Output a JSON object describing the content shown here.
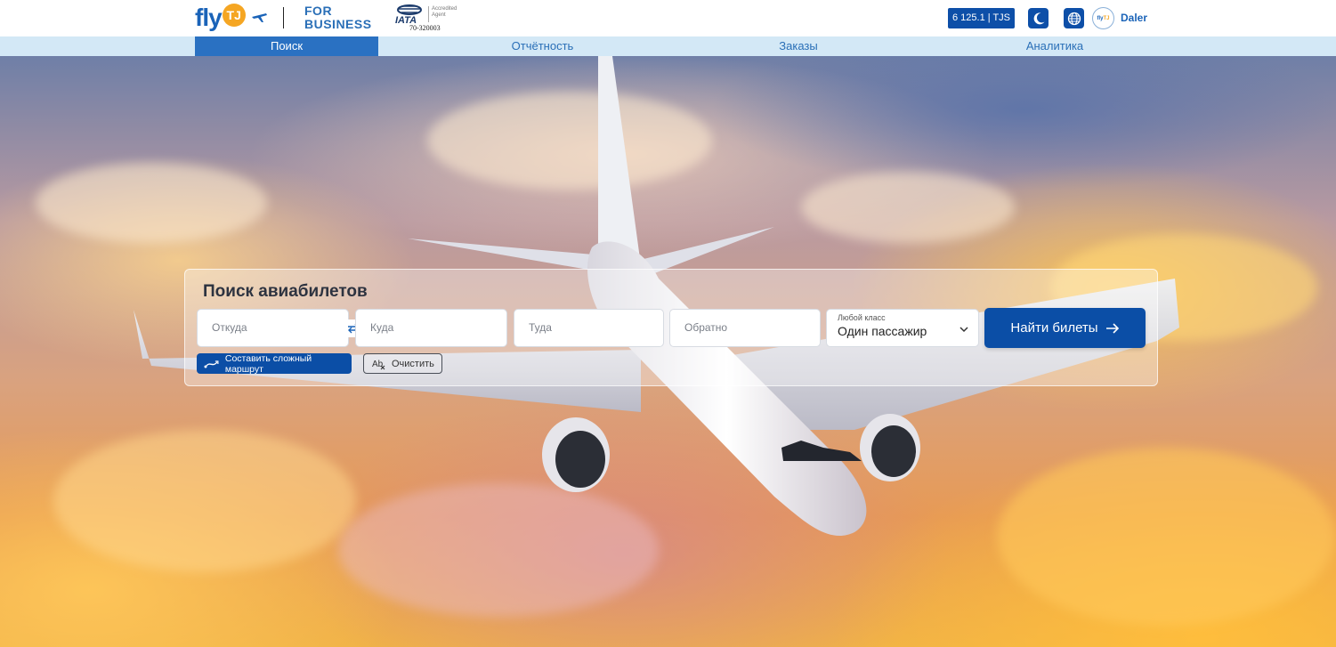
{
  "header": {
    "logo": {
      "fly": "fly",
      "tj": "TJ"
    },
    "for_business": [
      "FOR",
      "BUSINESS"
    ],
    "iata": {
      "word": "IATA",
      "accredited": "Accredited Agent",
      "number": "70-320003"
    },
    "balance": "6 125.1 | TJS",
    "avatar_text": {
      "fly": "fly",
      "tj": "TJ"
    },
    "username": "Daler",
    "icons": {
      "theme": "moon-icon",
      "language": "globe-icon"
    }
  },
  "nav": {
    "items": [
      {
        "label": "Поиск",
        "active": true
      },
      {
        "label": "Отчётность",
        "active": false
      },
      {
        "label": "Заказы",
        "active": false
      },
      {
        "label": "Аналитика",
        "active": false
      }
    ]
  },
  "search": {
    "title": "Поиск авиабилетов",
    "from_placeholder": "Откуда",
    "to_placeholder": "Куда",
    "depart_placeholder": "Туда",
    "return_placeholder": "Обратно",
    "class_caption": "Любой класс",
    "passengers_value": "Один пассажир",
    "submit_label": "Найти билеты",
    "complex_route_label": "Составить сложный маршрут",
    "clear_label": "Очистить"
  },
  "colors": {
    "brand_blue": "#0b4ea6",
    "nav_bg": "#d3e8f6",
    "nav_active": "#2a71c2",
    "accent_orange": "#f5a623"
  }
}
